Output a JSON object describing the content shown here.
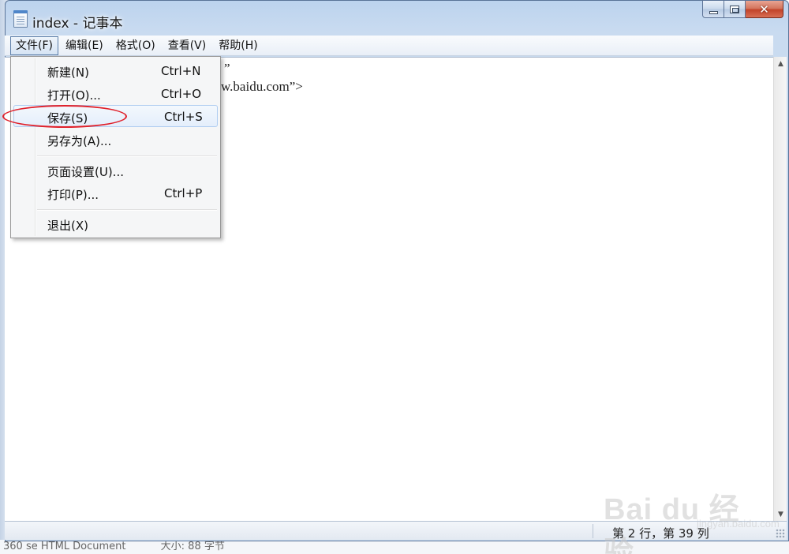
{
  "window": {
    "title": "index - 记事本"
  },
  "menubar": {
    "items": [
      "文件(F)",
      "编辑(E)",
      "格式(O)",
      "查看(V)",
      "帮助(H)"
    ]
  },
  "editor": {
    "visible_fragments": [
      "”",
      "w.baidu.com”>"
    ]
  },
  "file_menu": {
    "new": {
      "label": "新建(N)",
      "shortcut": "Ctrl+N"
    },
    "open": {
      "label": "打开(O)...",
      "shortcut": "Ctrl+O"
    },
    "save": {
      "label": "保存(S)",
      "shortcut": "Ctrl+S"
    },
    "save_as": {
      "label": "另存为(A)..."
    },
    "page_setup": {
      "label": "页面设置(U)..."
    },
    "print": {
      "label": "打印(P)...",
      "shortcut": "Ctrl+P"
    },
    "exit": {
      "label": "退出(X)"
    }
  },
  "statusbar": {
    "position": "第 2 行，第 39 列"
  },
  "background": {
    "file_type": "360 se HTML Document",
    "size_text": "大小: 88 字节"
  },
  "watermark": {
    "brand": "Bai du 经验",
    "domain": "jingyan.baidu.com"
  },
  "colors": {
    "highlight_ellipse": "#e0202a",
    "menu_hover_border": "#b0cdf1"
  }
}
